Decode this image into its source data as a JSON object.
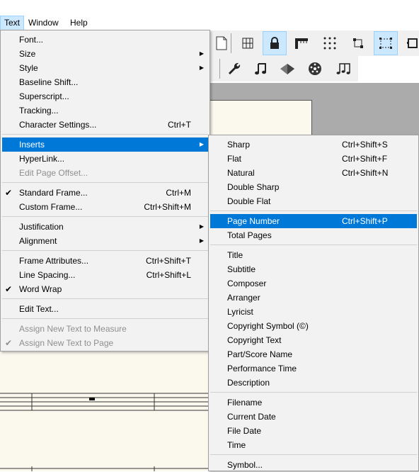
{
  "menubar": {
    "items": [
      "Text",
      "Window",
      "Help"
    ]
  },
  "text_menu": [
    {
      "label": "Font...",
      "shortcut": "",
      "arrow": false,
      "disabled": false,
      "checked": false
    },
    {
      "label": "Size",
      "shortcut": "",
      "arrow": true,
      "disabled": false,
      "checked": false
    },
    {
      "label": "Style",
      "shortcut": "",
      "arrow": true,
      "disabled": false,
      "checked": false
    },
    {
      "label": "Baseline Shift...",
      "shortcut": "",
      "arrow": false,
      "disabled": false,
      "checked": false
    },
    {
      "label": "Superscript...",
      "shortcut": "",
      "arrow": false,
      "disabled": false,
      "checked": false
    },
    {
      "label": "Tracking...",
      "shortcut": "",
      "arrow": false,
      "disabled": false,
      "checked": false
    },
    {
      "label": "Character Settings...",
      "shortcut": "Ctrl+T",
      "arrow": false,
      "disabled": false,
      "checked": false
    },
    {
      "label": "Inserts",
      "shortcut": "",
      "arrow": true,
      "disabled": false,
      "checked": false,
      "highlighted": true
    },
    {
      "label": "HyperLink...",
      "shortcut": "",
      "arrow": false,
      "disabled": false,
      "checked": false
    },
    {
      "label": "Edit Page Offset...",
      "shortcut": "",
      "arrow": false,
      "disabled": true,
      "checked": false
    },
    {
      "label": "Standard Frame...",
      "shortcut": "Ctrl+M",
      "arrow": false,
      "disabled": false,
      "checked": true
    },
    {
      "label": "Custom Frame...",
      "shortcut": "Ctrl+Shift+M",
      "arrow": false,
      "disabled": false,
      "checked": false
    },
    {
      "label": "Justification",
      "shortcut": "",
      "arrow": true,
      "disabled": false,
      "checked": false
    },
    {
      "label": "Alignment",
      "shortcut": "",
      "arrow": true,
      "disabled": false,
      "checked": false
    },
    {
      "label": "Frame Attributes...",
      "shortcut": "Ctrl+Shift+T",
      "arrow": false,
      "disabled": false,
      "checked": false
    },
    {
      "label": "Line Spacing...",
      "shortcut": "Ctrl+Shift+L",
      "arrow": false,
      "disabled": false,
      "checked": false
    },
    {
      "label": "Word Wrap",
      "shortcut": "",
      "arrow": false,
      "disabled": false,
      "checked": true
    },
    {
      "label": "Edit Text...",
      "shortcut": "",
      "arrow": false,
      "disabled": false,
      "checked": false
    },
    {
      "label": "Assign New Text to Measure",
      "shortcut": "",
      "arrow": false,
      "disabled": true,
      "checked": false
    },
    {
      "label": "Assign New Text to Page",
      "shortcut": "",
      "arrow": false,
      "disabled": true,
      "checked": true
    }
  ],
  "inserts_menu": [
    {
      "label": "Sharp",
      "shortcut": "Ctrl+Shift+S"
    },
    {
      "label": "Flat",
      "shortcut": "Ctrl+Shift+F"
    },
    {
      "label": "Natural",
      "shortcut": "Ctrl+Shift+N"
    },
    {
      "label": "Double Sharp",
      "shortcut": ""
    },
    {
      "label": "Double Flat",
      "shortcut": ""
    },
    {
      "label": "Page Number",
      "shortcut": "Ctrl+Shift+P",
      "highlighted": true
    },
    {
      "label": "Total Pages",
      "shortcut": ""
    },
    {
      "label": "Title",
      "shortcut": ""
    },
    {
      "label": "Subtitle",
      "shortcut": ""
    },
    {
      "label": "Composer",
      "shortcut": ""
    },
    {
      "label": "Arranger",
      "shortcut": ""
    },
    {
      "label": "Lyricist",
      "shortcut": ""
    },
    {
      "label": "Copyright Symbol (©)",
      "shortcut": ""
    },
    {
      "label": "Copyright Text",
      "shortcut": ""
    },
    {
      "label": "Part/Score Name",
      "shortcut": ""
    },
    {
      "label": "Performance Time",
      "shortcut": ""
    },
    {
      "label": "Description",
      "shortcut": ""
    },
    {
      "label": "Filename",
      "shortcut": ""
    },
    {
      "label": "Current Date",
      "shortcut": ""
    },
    {
      "label": "File Date",
      "shortcut": ""
    },
    {
      "label": "Time",
      "shortcut": ""
    },
    {
      "label": "Symbol...",
      "shortcut": ""
    }
  ],
  "toolbar_icons": {
    "row1": [
      "page-icon",
      "measure-tool-icon",
      "lock-icon",
      "ruler-icon",
      "dotted-grid-icon",
      "handles-icon",
      "selection-rect-icon",
      "frame-icon"
    ],
    "row2": [
      "wrench-icon",
      "music-note-icon",
      "staff-tool-icon",
      "disc-icon",
      "notes-cluster-icon"
    ]
  },
  "colors": {
    "highlight": "#0078d7",
    "active_menubar": "#cce8ff",
    "paper": "#fbf8ee"
  }
}
